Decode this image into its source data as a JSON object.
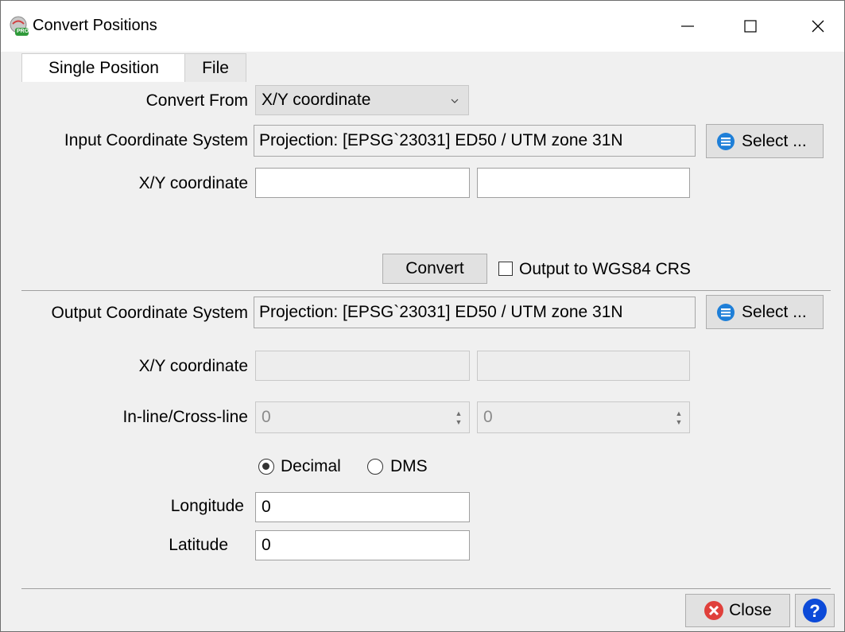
{
  "window": {
    "title": "Convert Positions",
    "icon_badge": "PRO",
    "controls": {
      "minimize": "minimize-icon",
      "maximize": "maximize-icon",
      "close": "close-icon"
    }
  },
  "tabs": [
    {
      "label": "Single Position",
      "active": true
    },
    {
      "label": "File",
      "active": false
    }
  ],
  "input": {
    "convert_from_label": "Convert From",
    "convert_from_value": "X/Y coordinate",
    "crs_label": "Input Coordinate System",
    "crs_value": "Projection: [EPSG`23031] ED50 / UTM zone 31N",
    "select_label": "Select ...",
    "xy_label": "X/Y coordinate",
    "x_value": "",
    "y_value": ""
  },
  "actions": {
    "convert_label": "Convert",
    "wgs84_label": "Output to WGS84 CRS",
    "wgs84_checked": false
  },
  "output": {
    "crs_label": "Output Coordinate System",
    "crs_value": "Projection: [EPSG`23031] ED50 / UTM zone 31N",
    "select_label": "Select ...",
    "xy_label": "X/Y coordinate",
    "x_value": "",
    "y_value": "",
    "inline_label": "In-line/Cross-line",
    "inline_value": "0",
    "crossline_value": "0",
    "format_decimal_label": "Decimal",
    "format_dms_label": "DMS",
    "format_selected": "Decimal",
    "longitude_label": "Longitude",
    "longitude_value": "0",
    "latitude_label": "Latitude",
    "latitude_value": "0"
  },
  "footer": {
    "close_label": "Close",
    "help_icon": "help-icon"
  },
  "colors": {
    "accent_blue": "#1e7fd8",
    "close_red": "#e0403b",
    "help_blue": "#0c4ad8",
    "window_bg": "#f0f0f0"
  }
}
